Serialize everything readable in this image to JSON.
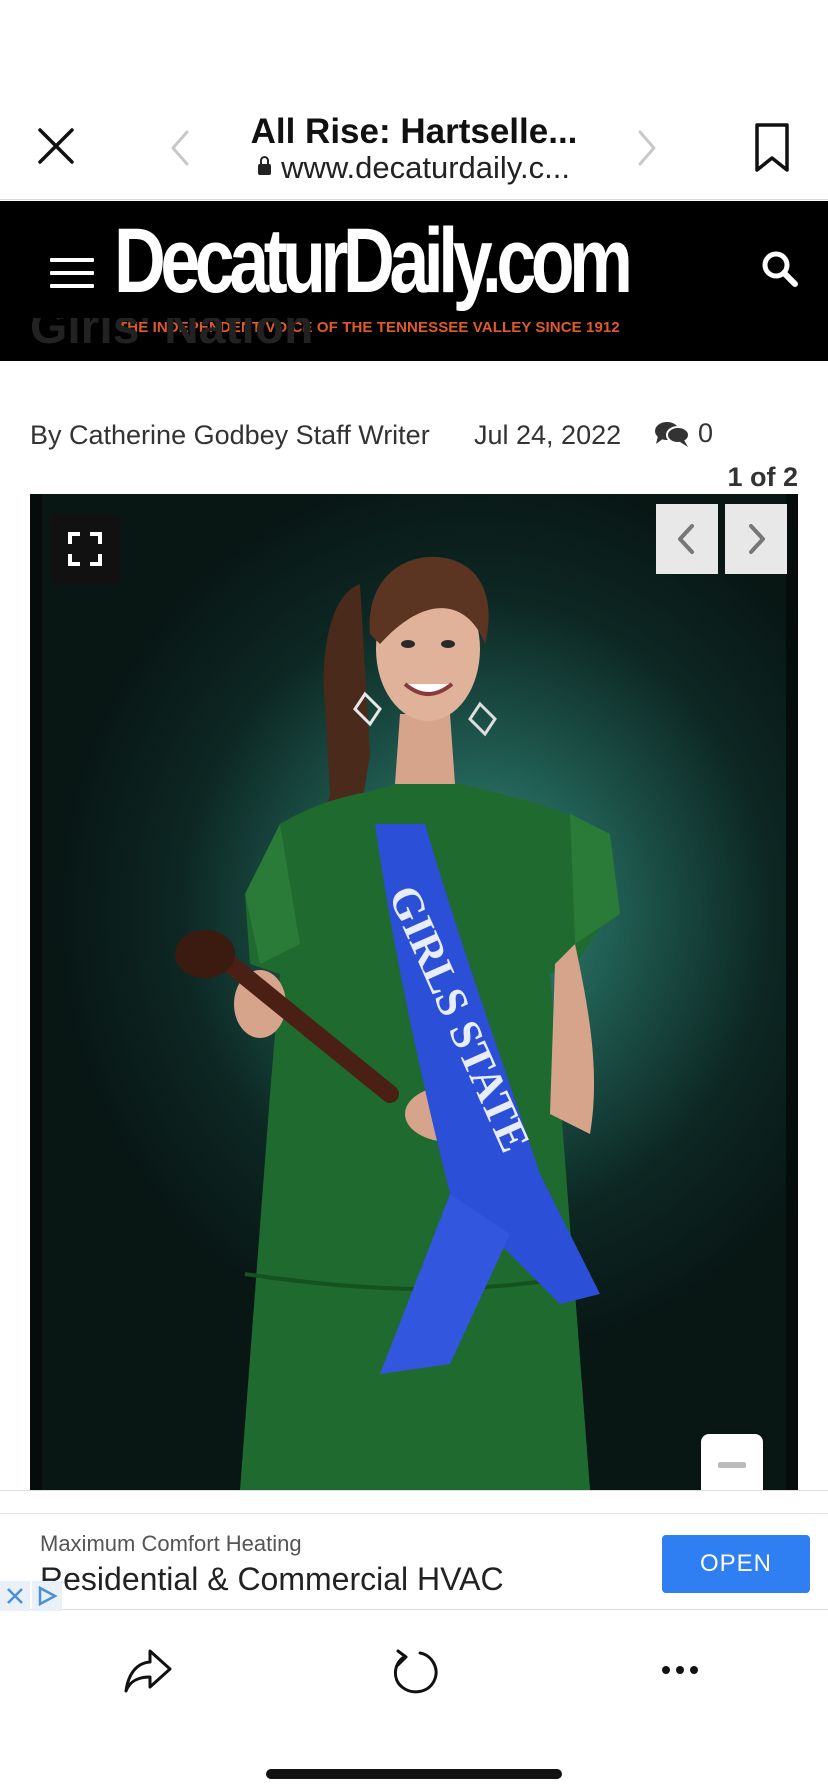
{
  "browser": {
    "title": "All Rise: Hartselle...",
    "url": "www.decaturdaily.c...",
    "icons": {
      "close": "close-icon",
      "back": "chevron-left-icon",
      "forward": "chevron-right-icon",
      "bookmark": "bookmark-icon",
      "lock": "lock-icon"
    }
  },
  "site": {
    "logo": "DecaturDaily.com",
    "tagline": "THE INDEPENDENT VOICE OF THE TENNESSEE VALLEY SINCE 1912",
    "tagline_color": "#e05a2a",
    "icons": {
      "menu": "hamburger-menu-icon",
      "search": "search-icon"
    }
  },
  "article": {
    "title_fragment": "Girls' Nation",
    "byline": "By Catherine Godbey Staff Writer",
    "date": "Jul 24, 2022",
    "comment_count": "0",
    "photo_counter": "1 of 2",
    "sash_text": "GIRLS STATE"
  },
  "ad": {
    "sponsor": "Maximum Comfort Heating",
    "headline": "Residential & Commercial HVAC",
    "cta": "OPEN",
    "cta_color": "#2f7ef2"
  },
  "toolbar": {
    "icons": {
      "share": "share-icon",
      "reload": "reload-icon",
      "more": "more-icon"
    }
  }
}
